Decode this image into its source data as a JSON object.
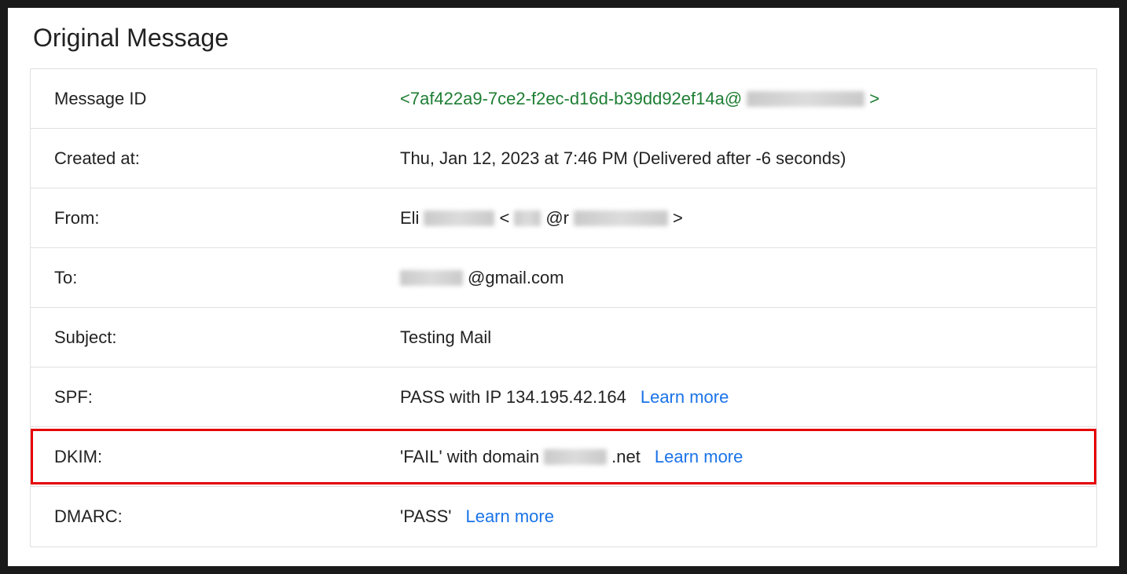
{
  "title": "Original Message",
  "rows": {
    "message_id_label": "Message ID",
    "message_id_prefix": "<7af422a9-7ce2-f2ec-d16d-b39dd92ef14a@",
    "message_id_suffix": ">",
    "created_label": "Created at:",
    "created_value": "Thu, Jan 12, 2023 at 7:46 PM (Delivered after -6 seconds)",
    "from_label": "From:",
    "from_name": "Eli ",
    "from_bracket_open": " <",
    "from_at": "@r",
    "from_bracket_close": ">",
    "to_label": "To:",
    "to_domain": "@gmail.com",
    "subject_label": "Subject:",
    "subject_value": "Testing Mail",
    "spf_label": "SPF:",
    "spf_value": "PASS with IP 134.195.42.164",
    "dkim_label": "DKIM:",
    "dkim_prefix": "'FAIL' with domain ",
    "dkim_suffix": ".net",
    "dmarc_label": "DMARC:",
    "dmarc_value": "'PASS'",
    "learn_more": "Learn more"
  }
}
